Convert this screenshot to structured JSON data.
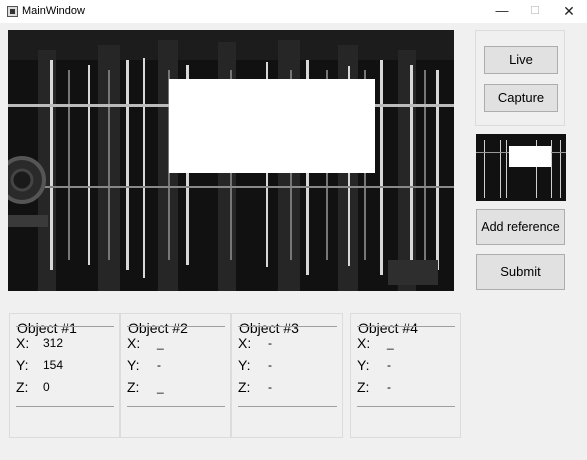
{
  "window": {
    "title": "MainWindow",
    "minimize_glyph": "—",
    "maximize_glyph": "☐",
    "close_glyph": "✕"
  },
  "controls": {
    "live_label": "Live",
    "capture_label": "Capture",
    "add_reference_label": "Add reference",
    "submit_label": "Submit"
  },
  "objects": [
    {
      "title": "Object #1",
      "x": "312",
      "y": "154",
      "z": "0"
    },
    {
      "title": "Object #2",
      "x": "_",
      "y": "-",
      "z": "_"
    },
    {
      "title": "Object #3",
      "x": "-",
      "y": "-",
      "z": "-"
    },
    {
      "title": "Object #4",
      "x": "_",
      "y": "-",
      "z": "-"
    }
  ],
  "axis_labels": {
    "x": "X:",
    "y": "Y:",
    "z": "Z:"
  },
  "colors": {
    "window_bg": "#f0f0f0",
    "button_bg": "#e1e1e1",
    "button_border": "#adadad",
    "camera_bg": "#0c0c0c"
  }
}
